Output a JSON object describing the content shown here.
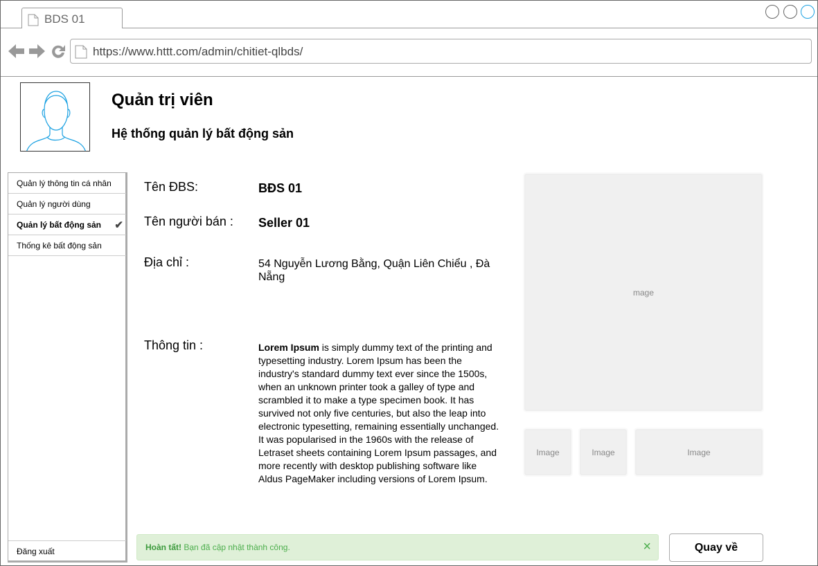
{
  "browser": {
    "tab_title": "BDS 01",
    "url": "https://www.httt.com/admin/chitiet-qlbds/"
  },
  "header": {
    "title": "Quản trị viên",
    "subtitle": "Hệ thống quản lý bất động sản"
  },
  "sidebar": {
    "items": [
      {
        "label": "Quản lý thông tin cá nhân"
      },
      {
        "label": "Quản lý người dùng"
      },
      {
        "label": "Quản lý bất động sản",
        "active": true
      },
      {
        "label": "Thống kê bất động sản"
      }
    ],
    "logout_label": "Đăng xuất"
  },
  "detail": {
    "name_label": "Tên ĐBS:",
    "name_value": "BĐS 01",
    "seller_label": "Tên người bán :",
    "seller_value": "Seller 01",
    "address_label": "Địa chỉ :",
    "address_value": "54 Nguyễn Lương Bằng, Quận Liên Chiểu , Đà Nẵng",
    "info_label": "Thông tin :",
    "info_bold": "Lorem Ipsum",
    "info_text": " is simply dummy text of the printing and typesetting industry. Lorem Ipsum has been the industry's standard dummy text ever since the 1500s, when an unknown printer took a galley of type and scrambled it to make a type specimen book. It has survived not only five centuries, but also the leap into electronic typesetting, remaining essentially unchanged. It was popularised in the 1960s with the release of Letraset sheets containing Lorem Ipsum passages, and more recently with desktop publishing software like Aldus PageMaker including versions of Lorem Ipsum."
  },
  "images": {
    "main_label": "mage",
    "thumb1_label": "Image",
    "thumb2_label": "Image",
    "thumb3_label": "Image"
  },
  "alert": {
    "strong": "Hoàn tất!",
    "message": " Bạn đã cập nhật thành công.",
    "close_icon": "×"
  },
  "back_button_label": "Quay về"
}
